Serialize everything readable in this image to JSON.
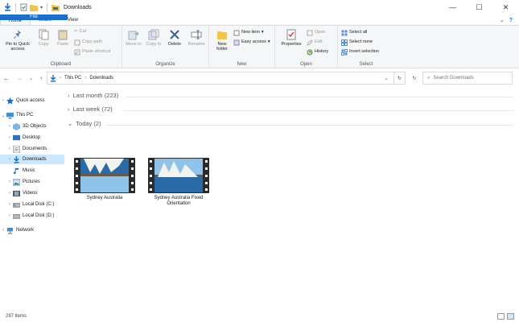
{
  "window": {
    "title": "Downloads",
    "controls": {
      "minimize": "—",
      "maximize": "☐",
      "close": "✕"
    }
  },
  "tabs": {
    "file": "File",
    "home": "Home",
    "share": "Share",
    "view": "View",
    "help": "?"
  },
  "ribbon": {
    "clipboard": {
      "label": "Clipboard",
      "pin": "Pin to Quick access",
      "copy": "Copy",
      "paste": "Paste",
      "cut": "Cut",
      "copy_path": "Copy path",
      "paste_shortcut": "Paste shortcut"
    },
    "organize": {
      "label": "Organize",
      "move_to": "Move to",
      "copy_to": "Copy to",
      "delete": "Delete",
      "rename": "Rename"
    },
    "new": {
      "label": "New",
      "new_folder": "New folder",
      "new_item": "New item",
      "easy_access": "Easy access"
    },
    "open": {
      "label": "Open",
      "properties": "Properties",
      "open": "Open",
      "edit": "Edit",
      "history": "History"
    },
    "select": {
      "label": "Select",
      "select_all": "Select all",
      "select_none": "Select none",
      "invert": "Invert selection"
    }
  },
  "address": {
    "crumbs": [
      "This PC",
      "Downloads"
    ],
    "search_placeholder": "Search Downloads"
  },
  "sidebar": [
    {
      "label": "Quick access",
      "icon": "star-icon"
    },
    {
      "label": "This PC",
      "icon": "computer-icon"
    },
    {
      "label": "3D Objects",
      "icon": "cube-icon"
    },
    {
      "label": "Desktop",
      "icon": "desktop-icon"
    },
    {
      "label": "Documents",
      "icon": "document-icon"
    },
    {
      "label": "Downloads",
      "icon": "download-icon"
    },
    {
      "label": "Music",
      "icon": "music-icon"
    },
    {
      "label": "Pictures",
      "icon": "picture-icon"
    },
    {
      "label": "Videos",
      "icon": "video-icon"
    },
    {
      "label": "Local Disk (C:)",
      "icon": "disk-icon"
    },
    {
      "label": "Local Disk (D:)",
      "icon": "disk-icon"
    },
    {
      "label": "Network",
      "icon": "network-icon"
    }
  ],
  "groups": [
    {
      "label": "Last month (223)",
      "expanded": false
    },
    {
      "label": "Last week (72)",
      "expanded": false
    },
    {
      "label": "Today (2)",
      "expanded": true
    }
  ],
  "files": [
    {
      "name": "Sydney Australia",
      "flipped": true
    },
    {
      "name": "Sydney Australia Fixed Orientation",
      "flipped": false
    }
  ],
  "status": {
    "count": "297 items"
  },
  "colors": {
    "accent": "#1a6fc9",
    "selection": "#cce8ff"
  }
}
